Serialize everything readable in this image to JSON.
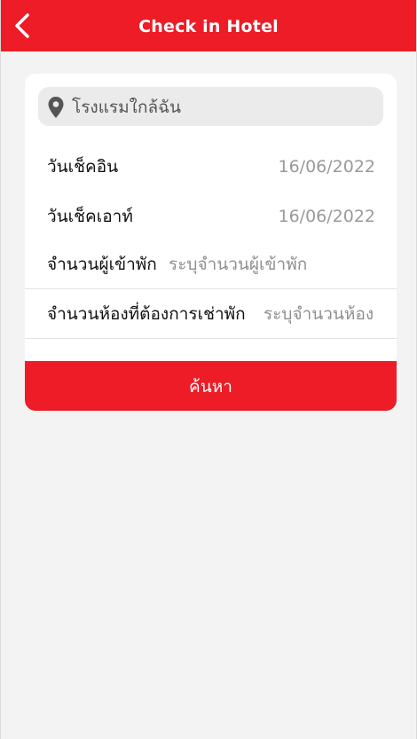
{
  "header": {
    "title": "Check in Hotel",
    "background_color": "#ee1c26",
    "back_icon": "chevron-left-icon"
  },
  "search": {
    "location_text": "โรงแรมใกล้ฉัน",
    "location_icon": "map-pin-icon"
  },
  "form": {
    "checkin_label": "วันเช็คอิน",
    "checkin_value": "16/06/2022",
    "checkout_label": "วันเช็คเอาท์",
    "checkout_value": "16/06/2022",
    "guests_label": "จำนวนผู้เข้าพัก",
    "guests_placeholder": "ระบุจำนวนผู้เข้าพัก",
    "rooms_label": "จำนวนห้องที่ต้องการเช่าพัก",
    "rooms_placeholder": "ระบุจำนวนห้อง"
  },
  "actions": {
    "search_label": "ค้นหา",
    "accent_color": "#ee1c26"
  }
}
